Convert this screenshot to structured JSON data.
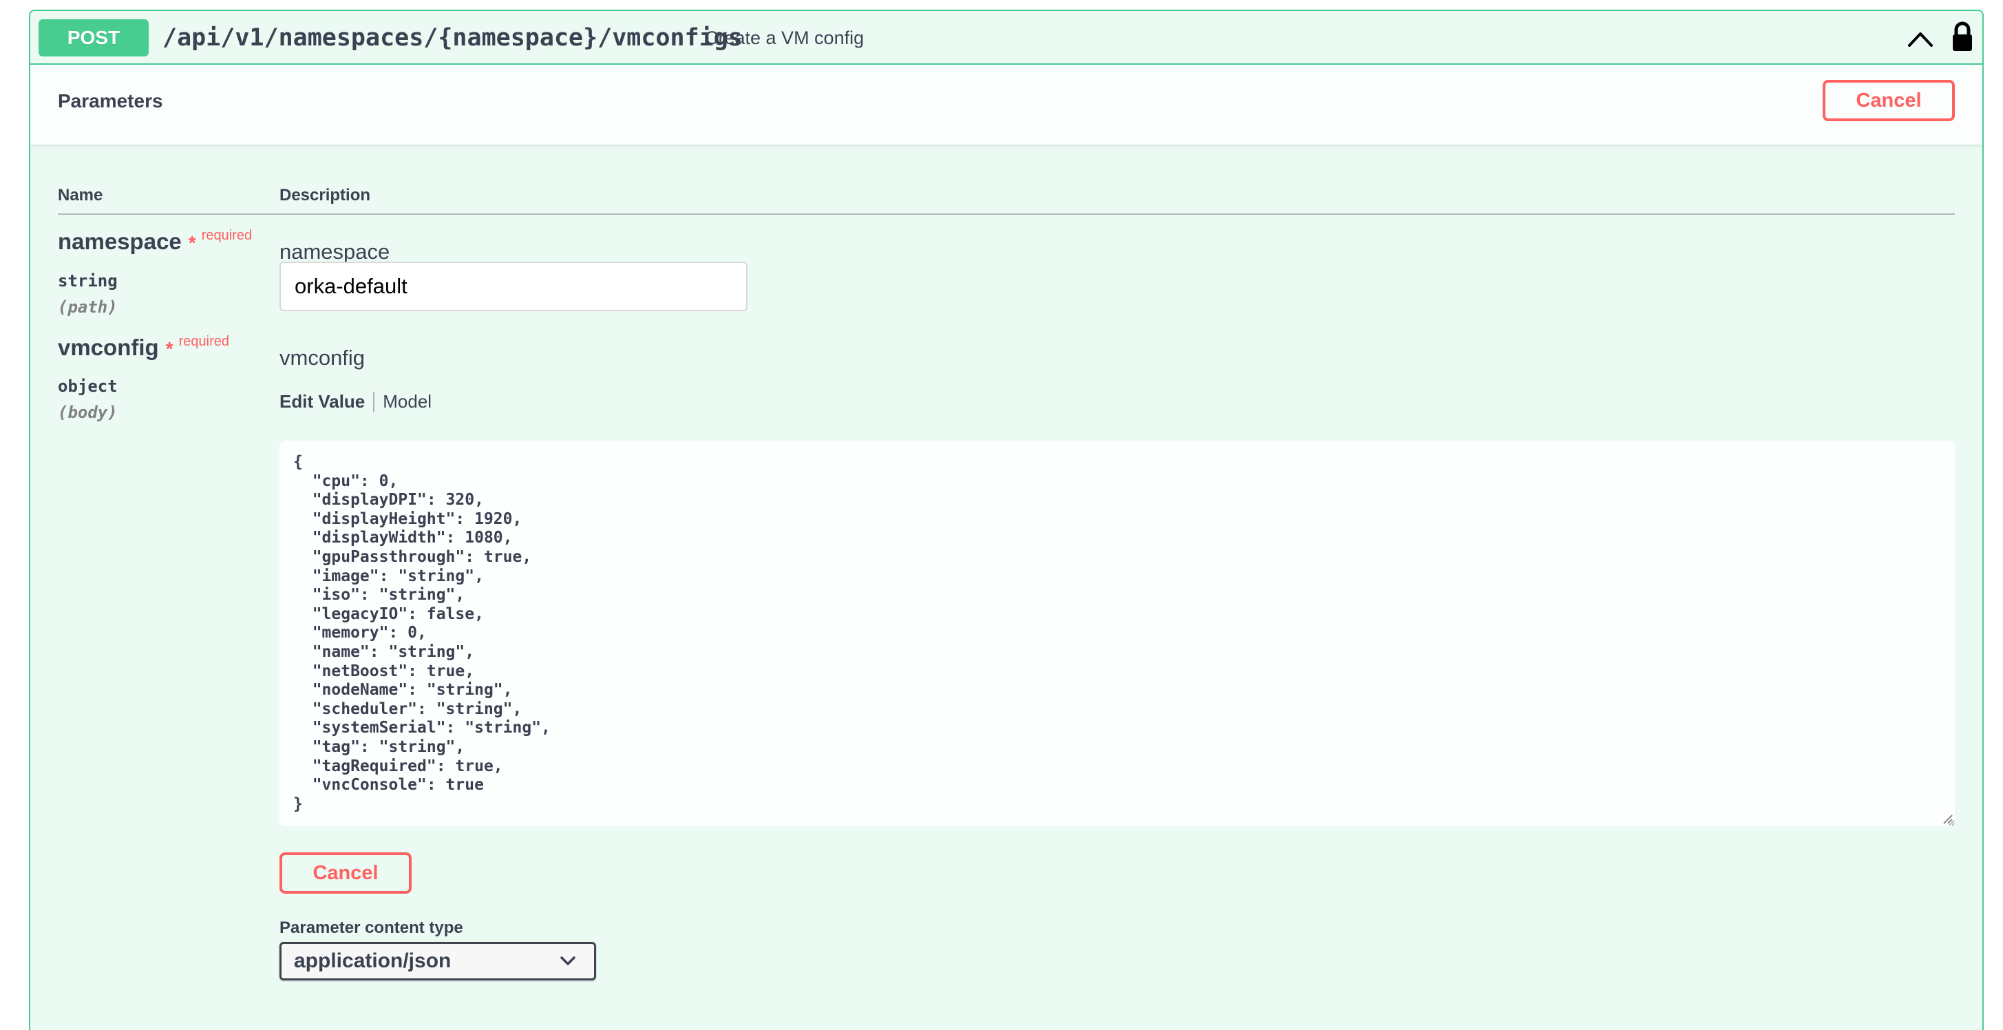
{
  "operation": {
    "method": "POST",
    "path": "/api/v1/namespaces/{namespace}/vmconfigs",
    "summary": "Create a VM config",
    "method_color": "#49cc90"
  },
  "parameters_section": {
    "title": "Parameters",
    "cancel_label": "Cancel",
    "columns": {
      "name": "Name",
      "description": "Description"
    }
  },
  "parameters": [
    {
      "name": "namespace",
      "required_star": "*",
      "required_label": "required",
      "type": "string",
      "in": "(path)",
      "description": "namespace",
      "value": "orka-default"
    },
    {
      "name": "vmconfig",
      "required_star": "*",
      "required_label": "required",
      "type": "object",
      "in": "(body)",
      "description": "vmconfig",
      "tabs": {
        "edit": "Edit Value",
        "model": "Model"
      },
      "body_value": "{\n  \"cpu\": 0,\n  \"displayDPI\": 320,\n  \"displayHeight\": 1920,\n  \"displayWidth\": 1080,\n  \"gpuPassthrough\": true,\n  \"image\": \"string\",\n  \"iso\": \"string\",\n  \"legacyIO\": false,\n  \"memory\": 0,\n  \"name\": \"string\",\n  \"netBoost\": true,\n  \"nodeName\": \"string\",\n  \"scheduler\": \"string\",\n  \"systemSerial\": \"string\",\n  \"tag\": \"string\",\n  \"tagRequired\": true,\n  \"vncConsole\": true\n}",
      "cancel_label": "Cancel",
      "content_type_label": "Parameter content type",
      "content_type": "application/json"
    }
  ],
  "colors": {
    "danger": "#ff6060",
    "text": "#3b4151"
  },
  "icons": {
    "collapse": "chevron-up-icon",
    "auth": "lock-icon",
    "select": "chevron-down-icon"
  }
}
